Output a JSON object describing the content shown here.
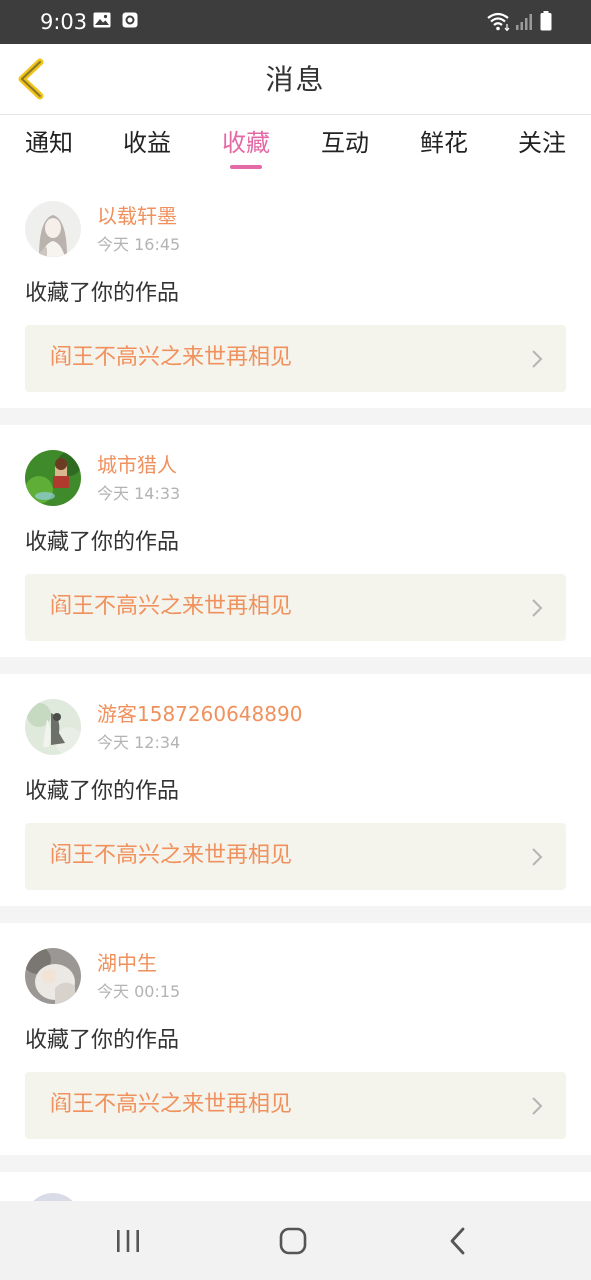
{
  "status_bar": {
    "time": "9:03"
  },
  "header": {
    "title": "消息",
    "back_icon": "chevron-left-icon",
    "back_color": "#f0c419"
  },
  "tabs": [
    {
      "label": "通知",
      "active": false
    },
    {
      "label": "收益",
      "active": false
    },
    {
      "label": "收藏",
      "active": true
    },
    {
      "label": "互动",
      "active": false
    },
    {
      "label": "鲜花",
      "active": false
    },
    {
      "label": "关注",
      "active": false
    }
  ],
  "colors": {
    "accent": "#e46aa6",
    "username": "#f0915d",
    "work_title": "#f0915d",
    "work_box_bg": "#f4f4ec",
    "timestamp": "#b3b3b3"
  },
  "notifications": [
    {
      "username": "以载轩墨",
      "time": "今天 16:45",
      "action": "收藏了你的作品",
      "work_title": "阎王不高兴之来世再相见"
    },
    {
      "username": "城市猎人",
      "time": "今天 14:33",
      "action": "收藏了你的作品",
      "work_title": "阎王不高兴之来世再相见"
    },
    {
      "username": "游客1587260648890",
      "time": "今天 12:34",
      "action": "收藏了你的作品",
      "work_title": "阎王不高兴之来世再相见"
    },
    {
      "username": "湖中生",
      "time": "今天 00:15",
      "action": "收藏了你的作品",
      "work_title": "阎王不高兴之来世再相见"
    }
  ],
  "nav_bar": {
    "buttons": [
      "recent-apps-icon",
      "home-icon",
      "back-icon"
    ]
  }
}
